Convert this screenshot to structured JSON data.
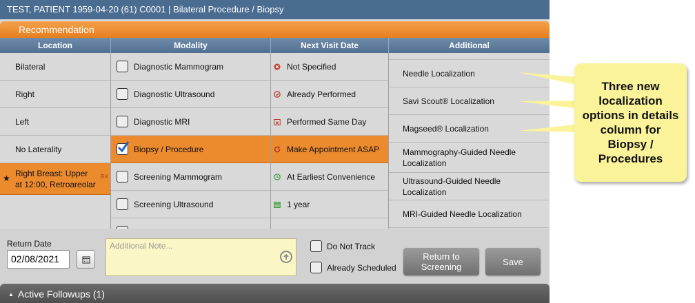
{
  "title_bar": "TEST, PATIENT 1959-04-20 (61) C0001 | Bilateral Procedure / Biopsy",
  "section_header": "Recommendation",
  "columns": {
    "location": "Location",
    "modality": "Modality",
    "next_visit": "Next Visit Date",
    "additional": "Additional"
  },
  "location_items": [
    "Bilateral",
    "Right",
    "Left",
    "No Laterality"
  ],
  "selected_location": {
    "label": "Right Breast: Upper at 12:00, Retroareolar",
    "badge": "BX",
    "icon": "star-icon"
  },
  "modality_items": [
    {
      "label": "Diagnostic Mammogram",
      "checked": false
    },
    {
      "label": "Diagnostic Ultrasound",
      "checked": false
    },
    {
      "label": "Diagnostic MRI",
      "checked": false
    },
    {
      "label": "Biopsy / Procedure",
      "checked": true
    },
    {
      "label": "Screening Mammogram",
      "checked": false
    },
    {
      "label": "Screening Ultrasound",
      "checked": false
    }
  ],
  "next_visit_items": [
    {
      "label": "Not Specified",
      "icon": "x-circle-icon",
      "color": "#c0392b"
    },
    {
      "label": "Already Performed",
      "icon": "check-circle-icon",
      "color": "#c0392b"
    },
    {
      "label": "Performed Same Day",
      "icon": "calendar-x-icon",
      "color": "#c0392b"
    },
    {
      "label": "Make Appointment ASAP",
      "icon": "refresh-icon",
      "color": "#a8322a"
    },
    {
      "label": "At Earliest Convenience",
      "icon": "clock-icon",
      "color": "#3a9a3a"
    },
    {
      "label": "1 year",
      "icon": "calendar-icon",
      "color": "#3a9a3a"
    }
  ],
  "additional_items": [
    "Needle Localization",
    "Savi Scout® Localization",
    "Magseed® Localization",
    "Mammography-Guided Needle Localization",
    "Ultrasound-Guided Needle Localization",
    "MRI-Guided Needle Localization"
  ],
  "return_date": {
    "label": "Return Date",
    "value": "02/08/2021"
  },
  "note": {
    "placeholder": "Additional Note..."
  },
  "checks": {
    "do_not_track": "Do Not Track",
    "already_scheduled": "Already Scheduled"
  },
  "buttons": {
    "return_to_screening": "Return to Screening",
    "save": "Save"
  },
  "footer": "Active Followups (1)",
  "callout": "Three new localization options in details column for Biopsy / Procedures",
  "colors": {
    "accent_orange": "#ec8a2e",
    "header_blue": "#4a6c91",
    "callout_yellow": "#fbf39a"
  }
}
